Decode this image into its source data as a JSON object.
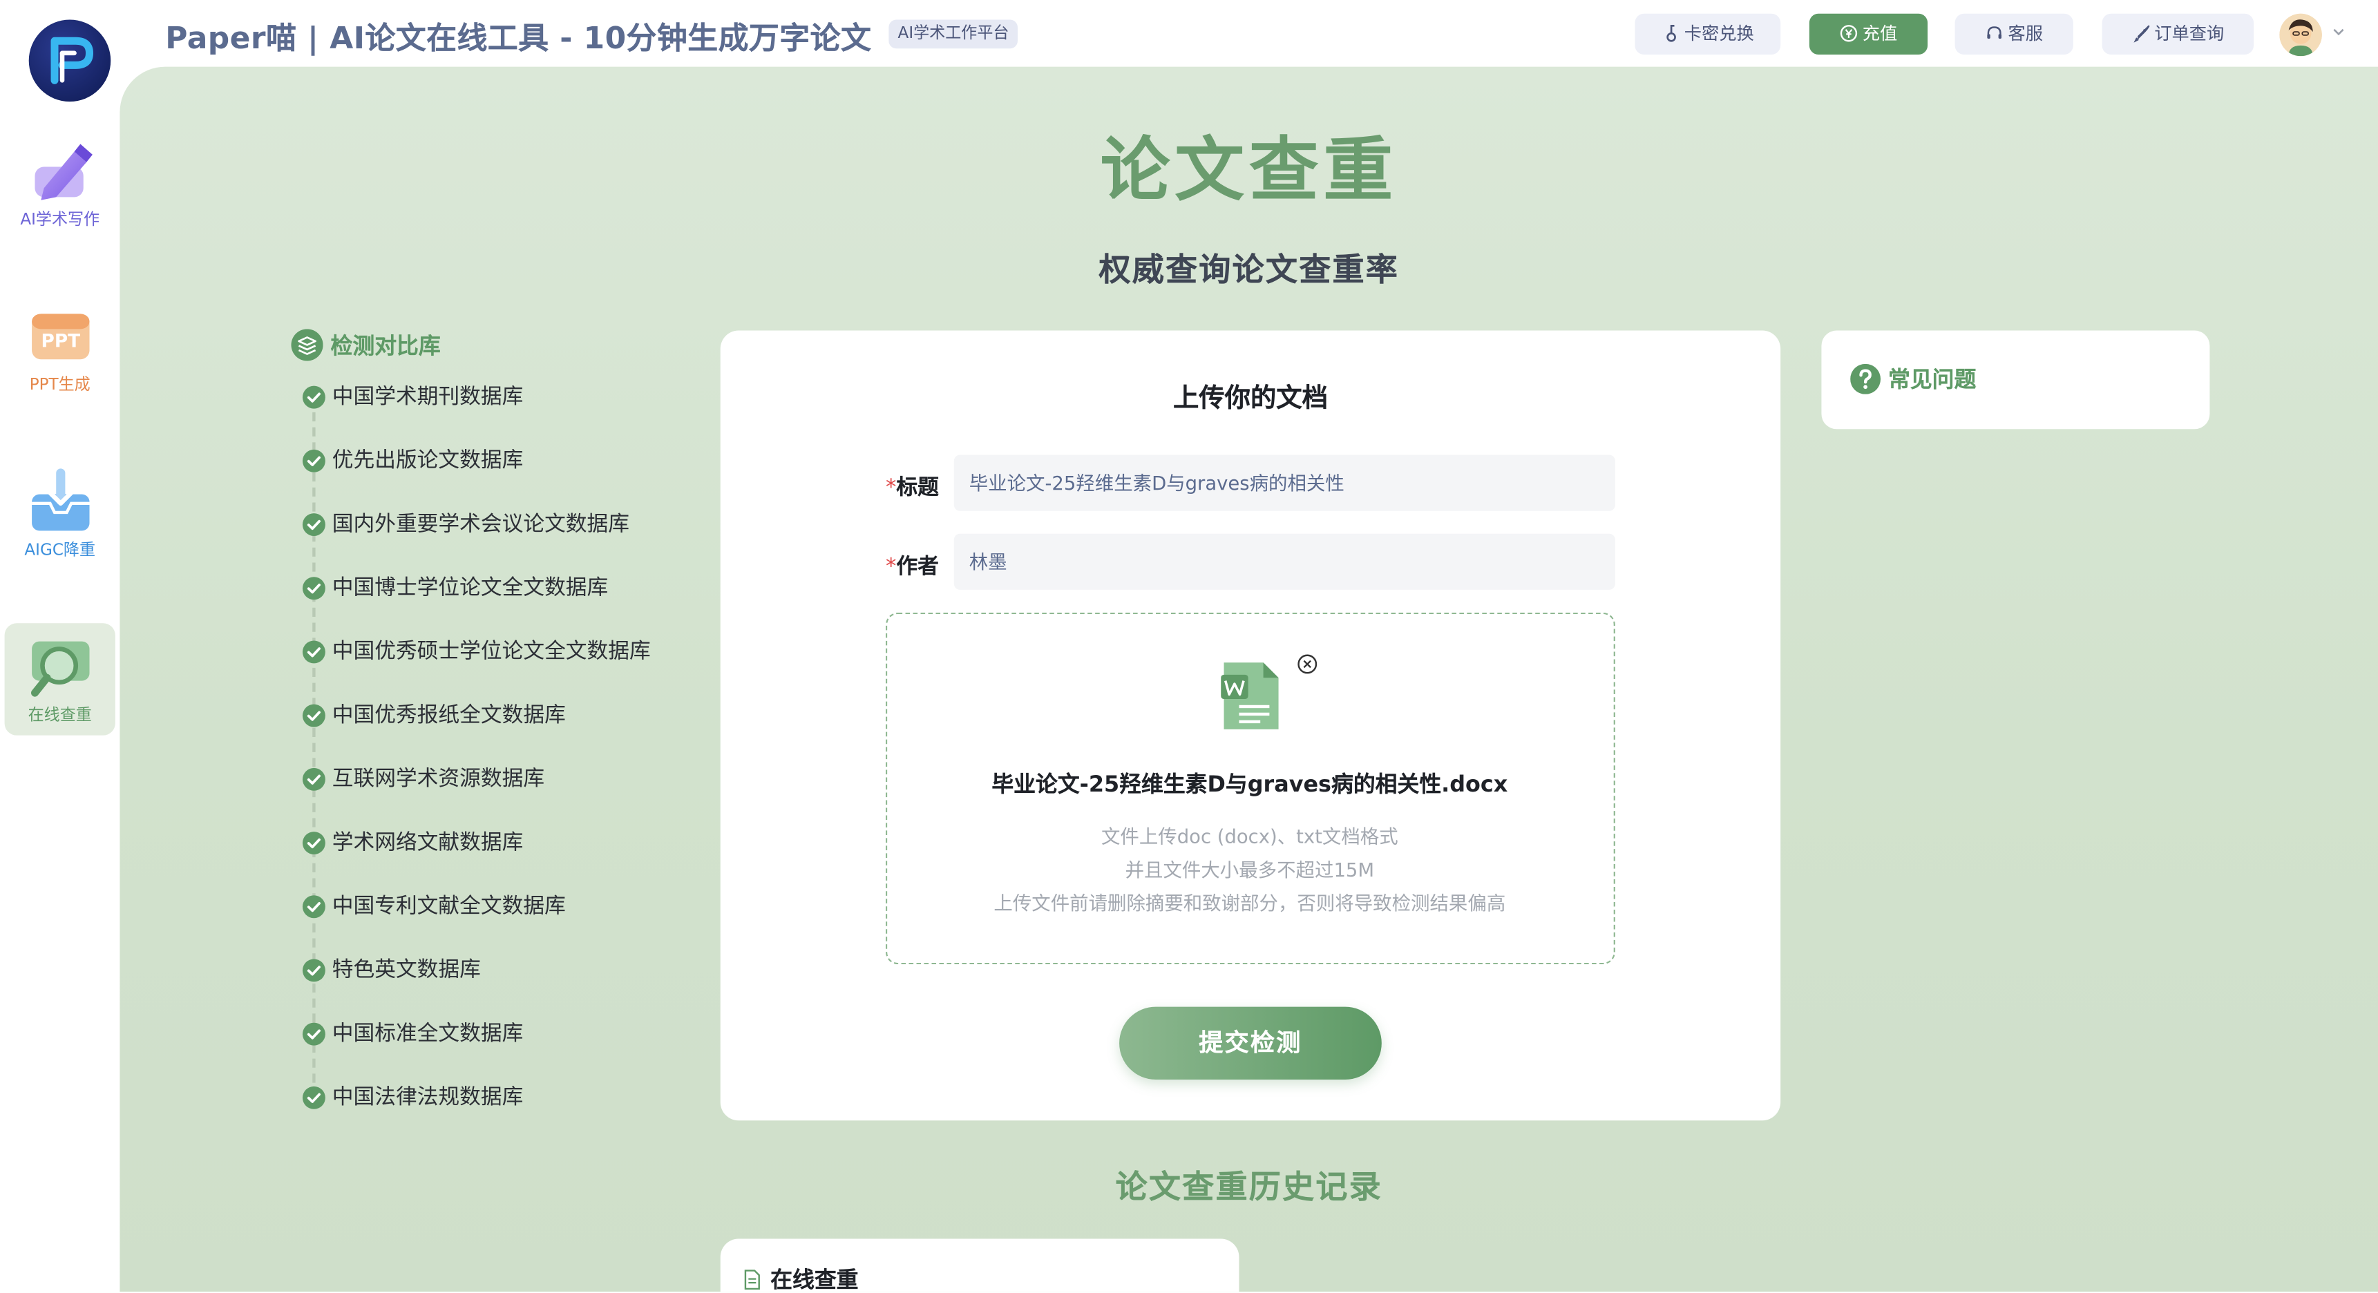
{
  "header": {
    "title": "Paper喵 | AI论文在线工具 - 10分钟生成万字论文",
    "badge": "AI学术工作平台",
    "buttons": {
      "card_redeem": "卡密兑换",
      "recharge": "充值",
      "customer_service": "客服",
      "order_query": "订单查询"
    }
  },
  "sidebar": {
    "items": [
      {
        "label": "AI学术写作",
        "icon": "pen-icon"
      },
      {
        "label": "PPT生成",
        "icon": "ppt-icon"
      },
      {
        "label": "AIGC降重",
        "icon": "inbox-download-icon"
      },
      {
        "label": "在线查重",
        "icon": "magnifier-icon",
        "active": true
      }
    ]
  },
  "main": {
    "title": "论文查重",
    "subtitle": "权威查询论文查重率",
    "databases": {
      "header": "检测对比库",
      "items": [
        "中国学术期刊数据库",
        "优先出版论文数据库",
        "国内外重要学术会议论文数据库",
        "中国博士学位论文全文数据库",
        "中国优秀硕士学位论文全文数据库",
        "中国优秀报纸全文数据库",
        "互联网学术资源数据库",
        "学术网络文献数据库",
        "中国专利文献全文数据库",
        "特色英文数据库",
        "中国标准全文数据库",
        "中国法律法规数据库"
      ]
    },
    "upload": {
      "title": "上传你的文档",
      "title_label": "标题",
      "title_value": "毕业论文-25羟维生素D与graves病的相关性",
      "author_label": "作者",
      "author_value": "林墨",
      "required_mark": "*",
      "file_name": "毕业论文-25羟维生素D与graves病的相关性.docx",
      "hints": [
        "文件上传doc (docx)、txt文档格式",
        "并且文件大小最多不超过15M",
        "上传文件前请删除摘要和致谢部分，否则将导致检测结果偏高"
      ],
      "submit": "提交检测"
    },
    "faq": {
      "title": "常见问题"
    },
    "history": {
      "title": "论文查重历史记录",
      "tab": "在线查重"
    }
  },
  "colors": {
    "accent": "#5e9a66",
    "title_green": "#6a9c6e",
    "header_text": "#5b6b8f",
    "background": "#d5e4d0",
    "required": "#e04a4a"
  }
}
